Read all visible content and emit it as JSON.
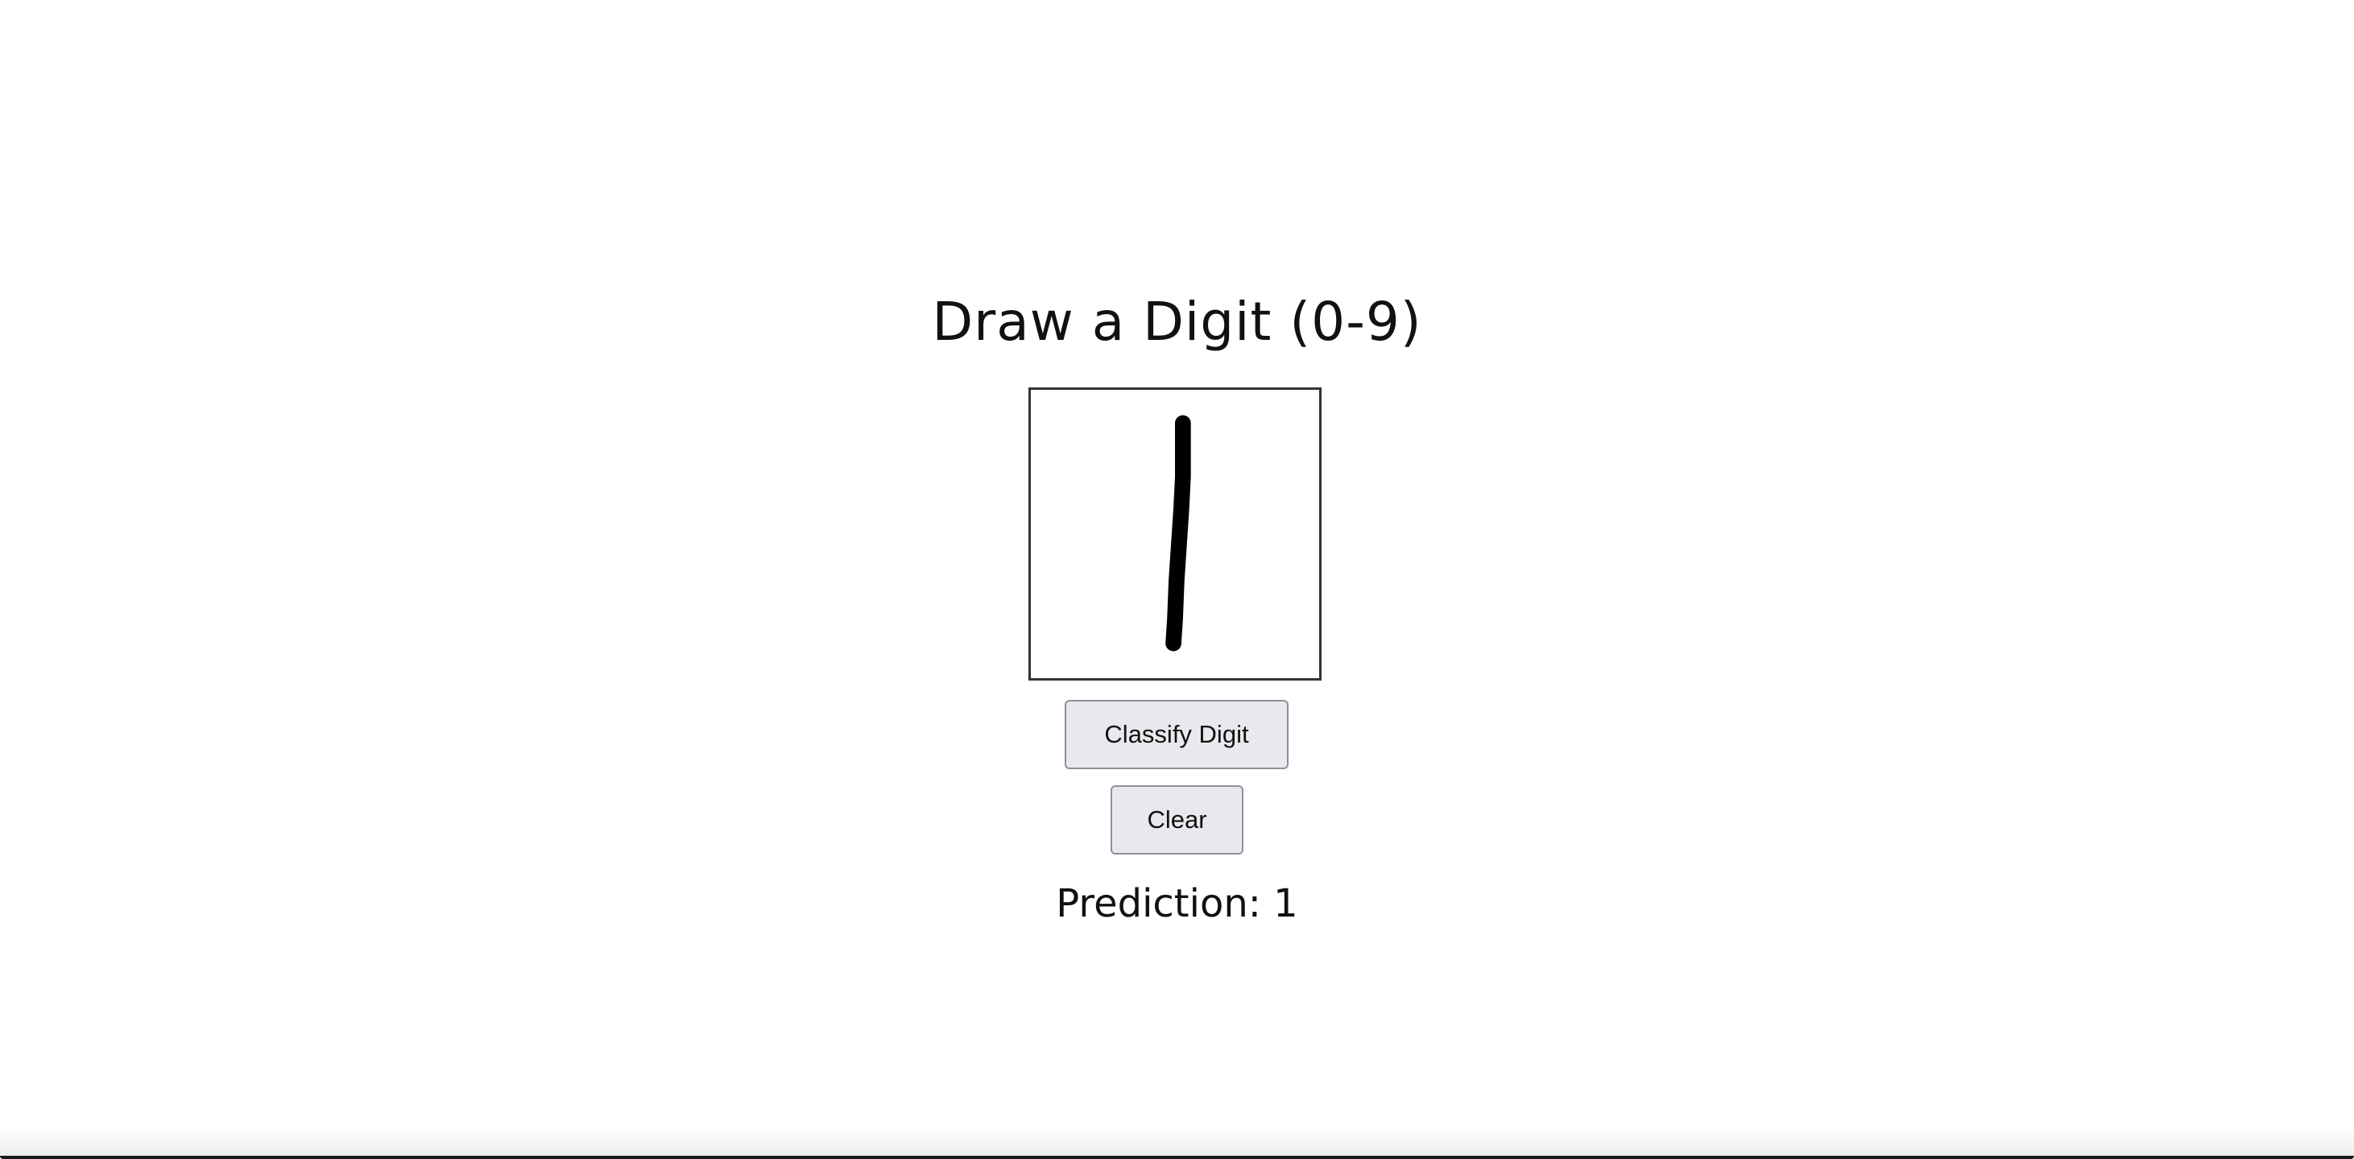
{
  "page": {
    "title": "Draw a Digit (0-9)"
  },
  "canvas": {
    "stroke_color": "#000000",
    "border_color": "#333333"
  },
  "buttons": {
    "classify_label": "Classify Digit",
    "clear_label": "Clear"
  },
  "result": {
    "prediction_text": "Prediction: 1"
  }
}
